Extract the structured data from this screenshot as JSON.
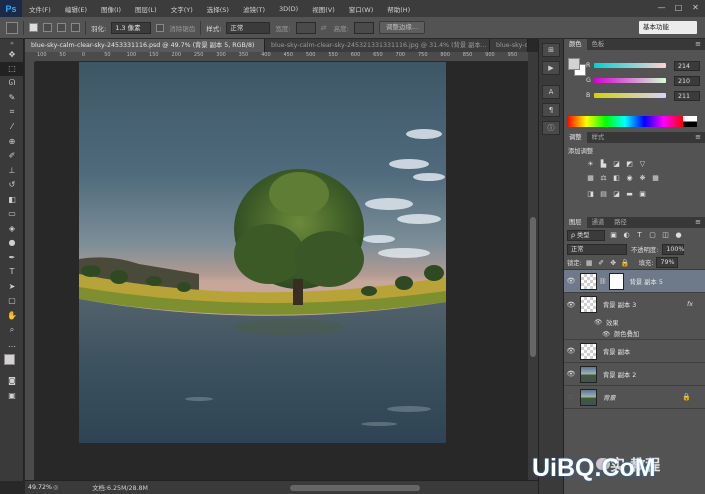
{
  "app": {
    "logo": "Ps"
  },
  "menu": [
    "文件(F)",
    "编辑(E)",
    "图像(I)",
    "图层(L)",
    "文字(Y)",
    "选择(S)",
    "滤镜(T)",
    "3D(D)",
    "视图(V)",
    "窗口(W)",
    "帮助(H)"
  ],
  "window_controls": {
    "minimize": "—",
    "restore": "□",
    "close": "✕"
  },
  "options": {
    "feather_label": "羽化:",
    "feather_value": "1.3 像素",
    "antialias_label": "消除锯齿",
    "style_label": "样式:",
    "style_value": "正常",
    "width_label": "宽度:",
    "height_label": "高度:",
    "refine_button": "调整边缘...",
    "workspace": "基本功能"
  },
  "documents": [
    {
      "title": "blue-sky-calm-clear-sky-2453331116.psd @ 49.7% (背景 副本 5, RGB/8)",
      "active": true
    },
    {
      "title": "blue-sky-calm-clear-sky-245321331331116.jpg @ 31.4% (背景 副本...",
      "active": false
    },
    {
      "title": "blue-sky-cal...",
      "active": false
    }
  ],
  "ruler_top": [
    "100",
    "50",
    "0",
    "50",
    "100",
    "150",
    "200",
    "250",
    "300",
    "350",
    "400",
    "450",
    "500",
    "550",
    "600",
    "650",
    "700",
    "750",
    "800",
    "850",
    "900",
    "950"
  ],
  "status": {
    "zoom": "49.72%",
    "doc_size": "文档:6.25M/28.8M"
  },
  "color_panel": {
    "tabs": [
      "颜色",
      "色板"
    ],
    "fg_color": "#d6d2d3",
    "bg_color": "#ffffff",
    "r_label": "R",
    "r_value": "214",
    "g_label": "G",
    "g_value": "210",
    "b_label": "B",
    "b_value": "211"
  },
  "adjust_panel": {
    "tabs": [
      "调整",
      "样式"
    ],
    "title": "添加调整"
  },
  "layers_panel": {
    "tabs": [
      "图层",
      "通道",
      "路径"
    ],
    "filter_type": "ρ 类型",
    "blend_mode": "正常",
    "opacity_label": "不透明度:",
    "opacity_value": "100%",
    "lock_label": "锁定:",
    "fill_label": "填充:",
    "fill_value": "79%",
    "layers": [
      {
        "name": "背景 副本 5",
        "selected": true,
        "thumb": "checker",
        "mask": true
      },
      {
        "name": "背景 副本 3",
        "selected": false,
        "thumb": "checker",
        "fx": "fx"
      },
      {
        "name": "背景 副本",
        "selected": false,
        "thumb": "checker"
      },
      {
        "name": "背景 副本 2",
        "selected": false,
        "thumb": "sky"
      },
      {
        "name": "背景",
        "selected": false,
        "thumb": "sky",
        "locked": true
      }
    ],
    "effects_label": "效果",
    "effect_item": "颜色叠加",
    "fx_badge": "fx"
  },
  "watermark": {
    "text": "UiBQ.CoM",
    "cn": "实 教程"
  }
}
